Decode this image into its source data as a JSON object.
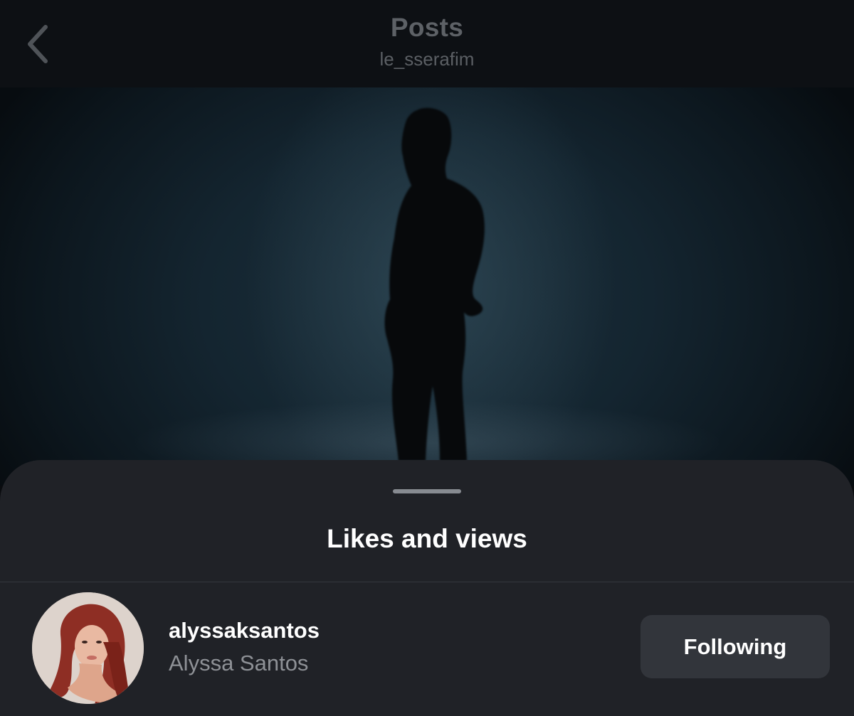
{
  "nav": {
    "title": "Posts",
    "subtitle": "le_sserafim",
    "back_icon": "chevron-left-icon"
  },
  "post": {
    "media": "silhouette-photo"
  },
  "sheet": {
    "title": "Likes and views"
  },
  "users": [
    {
      "username": "alyssaksantos",
      "full_name": "Alyssa Santos",
      "button_label": "Following",
      "avatar": "profile-photo"
    }
  ],
  "colors": {
    "nav_bg": "#0d1014",
    "sheet_bg": "#202227",
    "button_bg": "#32353b",
    "secondary_text": "#8e9196"
  }
}
